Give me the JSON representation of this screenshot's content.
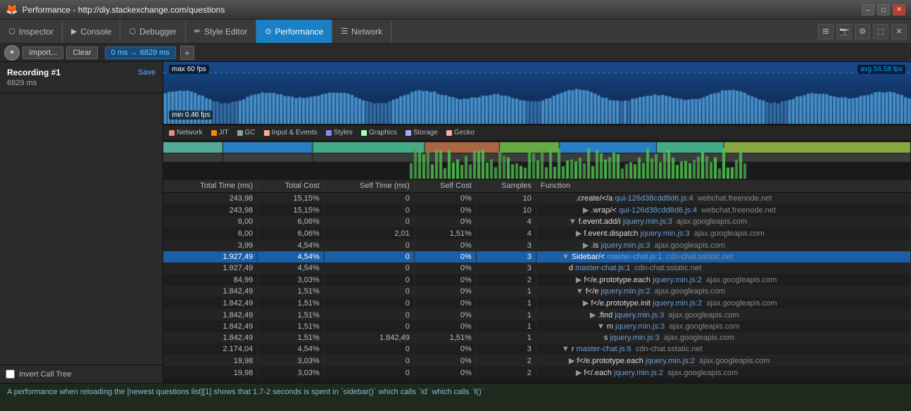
{
  "titlebar": {
    "title": "Performance - http://diy.stackexchange.com/questions",
    "ff_icon": "🦊",
    "win_min": "–",
    "win_max": "□",
    "win_close": "✕"
  },
  "tabs": [
    {
      "label": "Inspector",
      "icon": "⬡",
      "active": false
    },
    {
      "label": "Console",
      "icon": "▶",
      "active": false
    },
    {
      "label": "Debugger",
      "icon": "⬡",
      "active": false
    },
    {
      "label": "Style Editor",
      "icon": "✏",
      "active": false
    },
    {
      "label": "Performance",
      "icon": "⊙",
      "active": true
    },
    {
      "label": "Network",
      "icon": "☰",
      "active": false
    }
  ],
  "toolbar": {
    "import_label": "Import...",
    "clear_label": "Clear",
    "range_label": "0 ms → 6829 ms"
  },
  "recording": {
    "title": "Recording #1",
    "duration": "6829 ms",
    "save_label": "Save"
  },
  "timeline": {
    "max_fps": "max 60 fps",
    "min_fps": "min 0.46 fps",
    "avg_fps": "avg 54.58 fps"
  },
  "legend": [
    {
      "color": "#e88",
      "label": "Network"
    },
    {
      "color": "#f80",
      "label": "JIT"
    },
    {
      "color": "#8a8",
      "label": "GC"
    },
    {
      "color": "#fa8",
      "label": "Input & Events"
    },
    {
      "color": "#88f",
      "label": "Styles"
    },
    {
      "color": "#afa",
      "label": "Graphics"
    },
    {
      "color": "#aaf",
      "label": "Storage"
    },
    {
      "color": "#faa",
      "label": "Gecko"
    }
  ],
  "table_headers": [
    "Total Time (ms)",
    "Total Cost",
    "Self Time (ms)",
    "Self Cost",
    "Samples",
    "Function"
  ],
  "table_rows": [
    {
      "total_time": "243,98",
      "total_cost": "15,15%",
      "self_time": "0",
      "self_cost": "0%",
      "samples": "10",
      "indent": 5,
      "arrow": "",
      "fn": ".create/</a",
      "fn_file": "qui-126d38cdd8d6.js:4",
      "domain": "webchat.freenode.net"
    },
    {
      "total_time": "243,98",
      "total_cost": "15,15%",
      "self_time": "0",
      "self_cost": "0%",
      "samples": "10",
      "indent": 6,
      "arrow": "▶",
      "fn": ".wrap/<",
      "fn_file": "qui-126d38cdd8d6.js:4",
      "domain": "webchat.freenode.net"
    },
    {
      "total_time": "6,00",
      "total_cost": "6,06%",
      "self_time": "0",
      "self_cost": "0%",
      "samples": "4",
      "indent": 4,
      "arrow": "▼",
      "fn": "f.event.add/i",
      "fn_file": "jquery.min.js:3",
      "domain": "ajax.googleapis.com"
    },
    {
      "total_time": "6,00",
      "total_cost": "6,06%",
      "self_time": "2,01",
      "self_cost": "1,51%",
      "samples": "4",
      "indent": 5,
      "arrow": "▶",
      "fn": "f.event.dispatch",
      "fn_file": "jquery.min.js:3",
      "domain": "ajax.googleapis.com"
    },
    {
      "total_time": "3,99",
      "total_cost": "4,54%",
      "self_time": "0",
      "self_cost": "0%",
      "samples": "3",
      "indent": 6,
      "arrow": "▶",
      "fn": ".is",
      "fn_file": "jquery.min.js:3",
      "domain": "ajax.googleapis.com"
    },
    {
      "total_time": "1.927,49",
      "total_cost": "4,54%",
      "self_time": "0",
      "self_cost": "0%",
      "samples": "3",
      "indent": 3,
      "arrow": "▼",
      "fn": "Sidebar/<",
      "fn_file": "master-chat.js:1",
      "domain": "cdn-chat.sstatic.net",
      "selected": true
    },
    {
      "total_time": "1.927,49",
      "total_cost": "4,54%",
      "self_time": "0",
      "self_cost": "0%",
      "samples": "3",
      "indent": 4,
      "arrow": "",
      "fn": "d",
      "fn_file": "master-chat.js:1",
      "domain": "cdn-chat.sstatic.net"
    },
    {
      "total_time": "84,99",
      "total_cost": "3,03%",
      "self_time": "0",
      "self_cost": "0%",
      "samples": "2",
      "indent": 5,
      "arrow": "▶",
      "fn": "f</e.prototype.each",
      "fn_file": "jquery.min.js:2",
      "domain": "ajax.googleapis.com"
    },
    {
      "total_time": "1.842,49",
      "total_cost": "1,51%",
      "self_time": "0",
      "self_cost": "0%",
      "samples": "1",
      "indent": 5,
      "arrow": "▼",
      "fn": "f</e",
      "fn_file": "jquery.min.js:2",
      "domain": "ajax.googleapis.com"
    },
    {
      "total_time": "1.842,49",
      "total_cost": "1,51%",
      "self_time": "0",
      "self_cost": "0%",
      "samples": "1",
      "indent": 6,
      "arrow": "▶",
      "fn": "f</e.prototype.init",
      "fn_file": "jquery.min.js:2",
      "domain": "ajax.googleapis.com"
    },
    {
      "total_time": "1.842,49",
      "total_cost": "1,51%",
      "self_time": "0",
      "self_cost": "0%",
      "samples": "1",
      "indent": 7,
      "arrow": "▶",
      "fn": ".find",
      "fn_file": "jquery.min.js:3",
      "domain": "ajax.googleapis.com"
    },
    {
      "total_time": "1.842,49",
      "total_cost": "1,51%",
      "self_time": "0",
      "self_cost": "0%",
      "samples": "1",
      "indent": 8,
      "arrow": "▼",
      "fn": "m",
      "fn_file": "jquery.min.js:3",
      "domain": "ajax.googleapis.com"
    },
    {
      "total_time": "1.842,49",
      "total_cost": "1,51%",
      "self_time": "1.842,49",
      "self_cost": "1,51%",
      "samples": "1",
      "indent": 9,
      "arrow": "",
      "fn": "s",
      "fn_file": "jquery.min.js:3",
      "domain": "ajax.googleapis.com"
    },
    {
      "total_time": "2.174,04",
      "total_cost": "4,54%",
      "self_time": "0",
      "self_cost": "0%",
      "samples": "3",
      "indent": 3,
      "arrow": "▼",
      "fn": "r",
      "fn_file": "master-chat.js:6",
      "domain": "cdn-chat.sstatic.net"
    },
    {
      "total_time": "19,98",
      "total_cost": "3,03%",
      "self_time": "0",
      "self_cost": "0%",
      "samples": "2",
      "indent": 4,
      "arrow": "▶",
      "fn": "f</e.prototype.each",
      "fn_file": "jquery.min.js:2",
      "domain": "ajax.googleapis.com"
    },
    {
      "total_time": "19,98",
      "total_cost": "3,03%",
      "self_time": "0",
      "self_cost": "0%",
      "samples": "2",
      "indent": 5,
      "arrow": "▶",
      "fn": "f</.each",
      "fn_file": "jquery.min.js:2",
      "domain": "ajax.googleapis.com"
    }
  ],
  "sidebar_footer": {
    "checkbox_label": "Invert Call Tree"
  },
  "bottom_console": {
    "text": "A performance when reloading the [newest questions list][1] shows that 1.7-2 seconds is spent in `sidebar()` which calls `Id` which calls `f()`"
  }
}
